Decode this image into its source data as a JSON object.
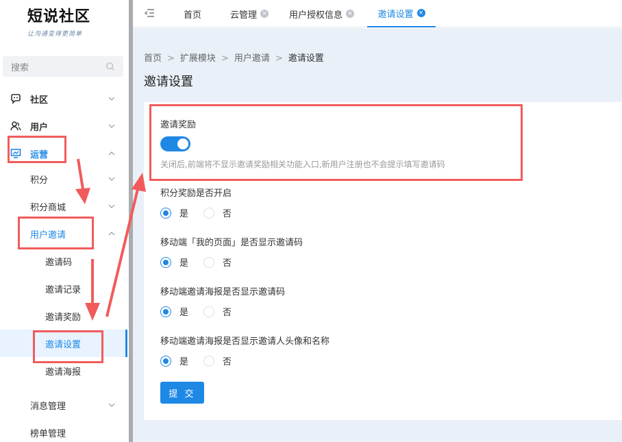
{
  "logo": {
    "main": "短说社区",
    "sub": "让沟通变得更简单"
  },
  "search": {
    "placeholder": "搜索"
  },
  "sidebar": {
    "items": [
      {
        "label": "社区",
        "icon": "chat-icon"
      },
      {
        "label": "用户",
        "icon": "users-icon"
      },
      {
        "label": "运营",
        "icon": "monitor-icon"
      },
      {
        "label": "积分"
      },
      {
        "label": "积分商城"
      },
      {
        "label": "用户邀请"
      },
      {
        "label": "邀请码"
      },
      {
        "label": "邀请记录"
      },
      {
        "label": "邀请奖励"
      },
      {
        "label": "邀请设置"
      },
      {
        "label": "邀请海报"
      },
      {
        "label": "消息管理"
      },
      {
        "label": "榜单管理"
      }
    ]
  },
  "tabs": [
    {
      "label": "首页"
    },
    {
      "label": "云管理"
    },
    {
      "label": "用户授权信息"
    },
    {
      "label": "邀请设置"
    }
  ],
  "breadcrumb": [
    "首页",
    "扩展模块",
    "用户邀请",
    "邀请设置"
  ],
  "breadcrumb_sep": ">",
  "page_title": "邀请设置",
  "form": {
    "reward_label": "邀请奖励",
    "reward_switch_on": true,
    "reward_help": "关闭后,前端将不显示邀请奖励相关功能入口,新用户注册也不会提示填写邀请码",
    "fields": [
      {
        "label": "积分奖励是否开启",
        "yes": "是",
        "no": "否",
        "selected": "是"
      },
      {
        "label": "移动端「我的页面」是否显示邀请码",
        "yes": "是",
        "no": "否",
        "selected": "是"
      },
      {
        "label": "移动端邀请海报是否显示邀请码",
        "yes": "是",
        "no": "否",
        "selected": "是"
      },
      {
        "label": "移动端邀请海报是否显示邀请人头像和名称",
        "yes": "是",
        "no": "否",
        "selected": "是"
      }
    ],
    "submit_label": "提 交"
  },
  "colors": {
    "accent": "#1e88e5",
    "annotation": "#f25b5b"
  }
}
